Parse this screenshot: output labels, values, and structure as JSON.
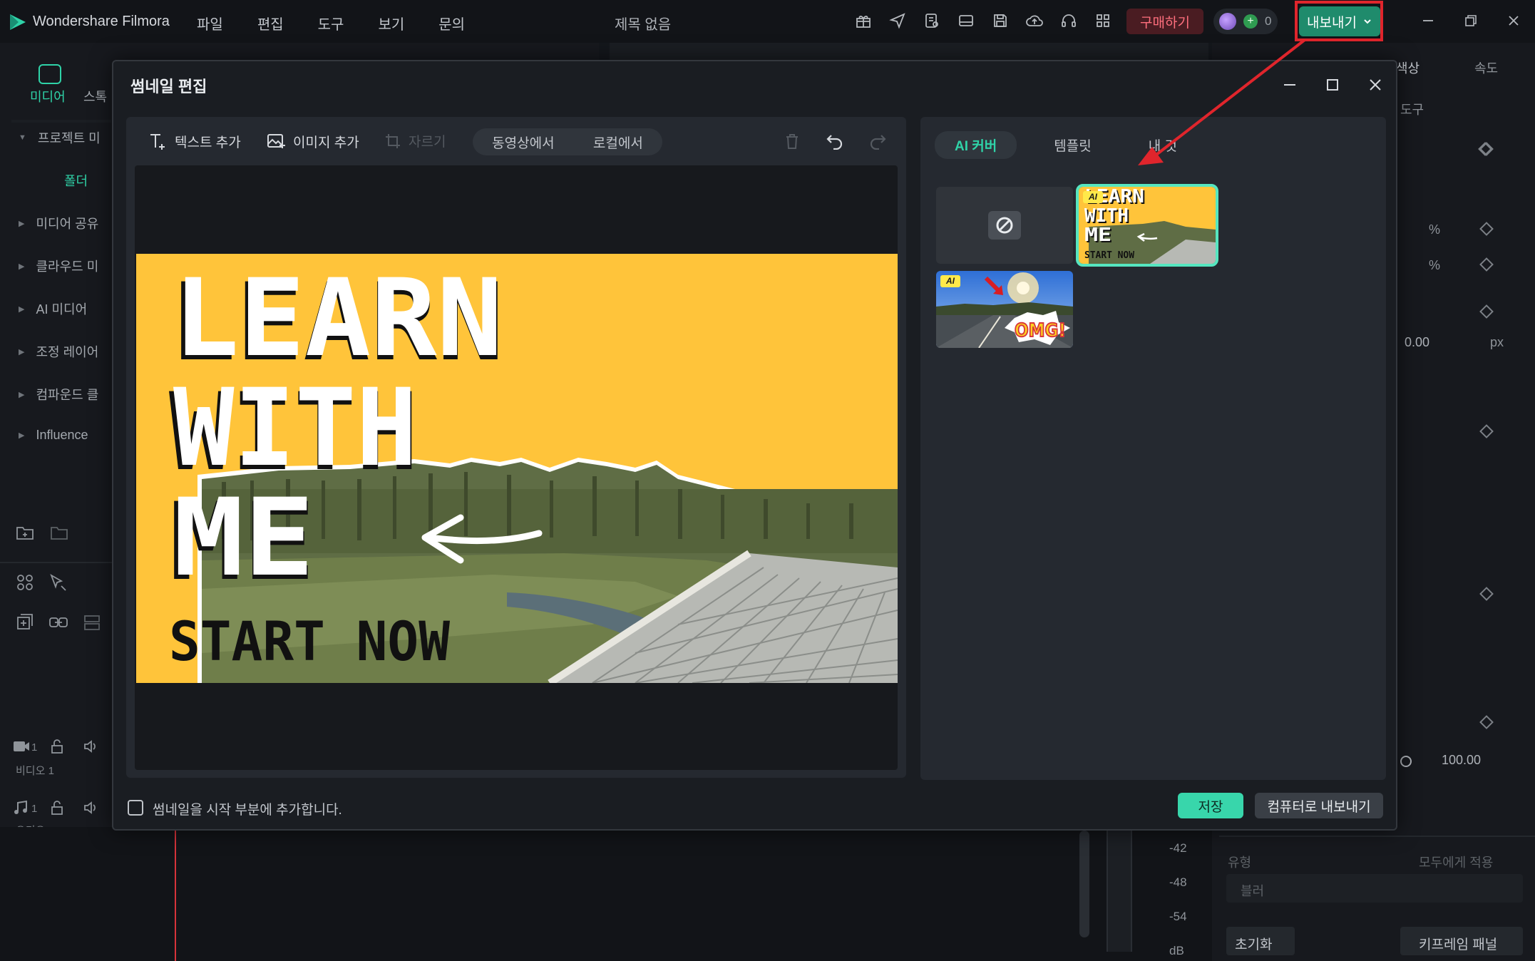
{
  "app": {
    "name": "Wondershare Filmora",
    "doc_title": "제목 없음",
    "menu": [
      "파일",
      "편집",
      "도구",
      "보기",
      "문의"
    ],
    "buy_label": "구매하기",
    "credits": "0",
    "export_label": "내보내기"
  },
  "left_panel": {
    "tabs": [
      "미디어",
      "스톡"
    ],
    "items": [
      "프로젝트 미",
      "폴더",
      "미디어 공유",
      "클라우드 미",
      "AI 미디어",
      "조정 레이어",
      "컴파운드 클",
      "Influence"
    ]
  },
  "right_panel": {
    "tabs": [
      "색상",
      "속도"
    ],
    "tool_label": "도구",
    "percent": "%",
    "value_px": "0.00",
    "unit_px": "px",
    "value_100": "100.00",
    "type_label": "유형",
    "apply_all": "모두에게 적용",
    "blur": "블러",
    "reset": "초기화",
    "keyframe_panel": "키프레임 패널"
  },
  "timeline": {
    "video_track": "비디오 1",
    "audio_track": "오디오 1",
    "track_num": "1",
    "meter": [
      "-42",
      "-48",
      "-54",
      "dB"
    ]
  },
  "dialog": {
    "title": "썸네일 편집",
    "toolbar": {
      "add_text": "텍스트 추가",
      "add_image": "이미지 추가",
      "crop": "자르기",
      "from_video": "동영상에서",
      "from_local": "로컬에서"
    },
    "thumbnail_text": {
      "line1": "LEARN",
      "line2": "WITH",
      "line3": "ME",
      "line4": "START NOW"
    },
    "cover_tabs": [
      "AI 커버",
      "템플릿",
      "내 것"
    ],
    "ai_badge": "AI",
    "omg_text": "OMG!",
    "footer": {
      "checkbox_label": "썸네일을 시작 부분에 추가합니다.",
      "save": "저장",
      "export_pc": "컴퓨터로 내보내기"
    }
  },
  "colors": {
    "accent": "#2fd3a8",
    "thumbnail_yellow": "#ffc43a",
    "highlight_red": "#e0252c"
  }
}
